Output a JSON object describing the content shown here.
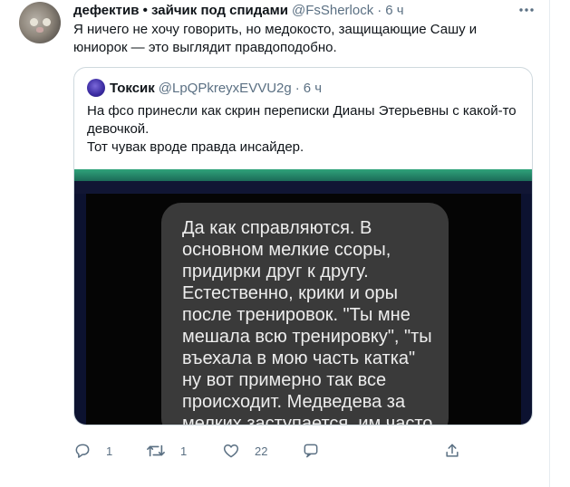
{
  "tweet": {
    "author_name": "дефектив • зайчик под спидами",
    "author_handle": "@FsSherlock",
    "dot": "·",
    "time": "6 ч",
    "text": "Я ничего не хочу говорить, но медокосто, защищающие Сашу и юниорок — это выглядит правдоподобно.",
    "avatar_icon": "cat-avatar",
    "more_icon": "more-options-icon"
  },
  "quote": {
    "author_name": "Токсик",
    "author_handle": "@LpQPkreyxEVVU2g",
    "dot": "·",
    "time": "6 ч",
    "text_line1": "На фсо принесли как скрин переписки Дианы Этерьевны с какой-то девочкой.",
    "text_line2": "Тот чувак вроде правда инсайдер.",
    "image_text": "Да как справляются. В\nосновном мелкие ссоры,\nпридирки друг к другу.\nЕстественно, крики и оры\nпосле тренировок. \"Ты мне\nмешала всю тренировку\", \"ты\nвъехала в мою часть катка\"\nну вот примерно так все\nпроисходит. Медведева за\nмелких заступается, им часто\nприлетает. Ну за юниорок то"
  },
  "actions": {
    "reply_count": "1",
    "retweet_count": "1",
    "like_count": "22"
  },
  "colors": {
    "text_primary": "#0f1419",
    "text_secondary": "#5b7083",
    "border": "#cfd9de"
  }
}
